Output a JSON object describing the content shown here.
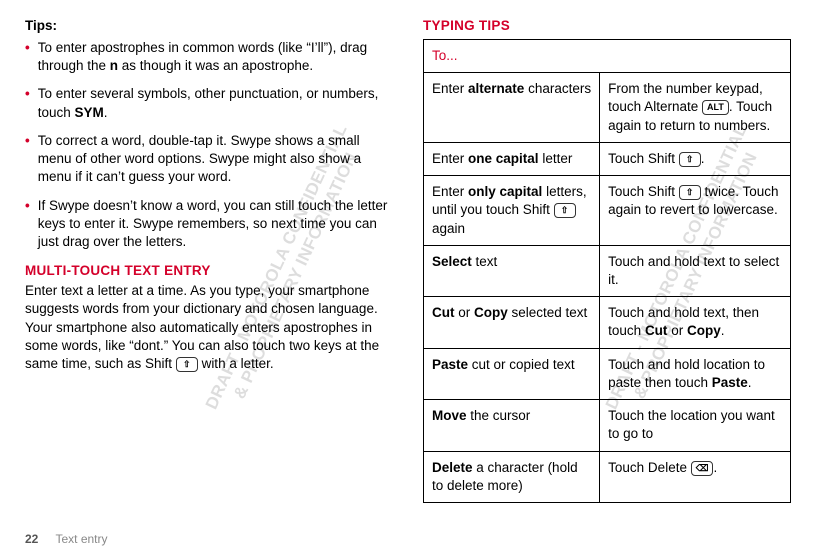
{
  "left": {
    "tipsLabel": "Tips:",
    "tips": [
      {
        "segments": [
          {
            "t": "To enter apostrophes in common words (like “I’ll”), drag through the "
          },
          {
            "t": "n",
            "b": true
          },
          {
            "t": " as though it was an apostrophe."
          }
        ]
      },
      {
        "segments": [
          {
            "t": "To enter several symbols, other punctuation, or numbers, touch "
          },
          {
            "t": "SYM",
            "b": true
          },
          {
            "t": "."
          }
        ]
      },
      {
        "segments": [
          {
            "t": "To correct a word, double-tap it. Swype shows a small menu of other word options. Swype might also show a menu if it can’t guess your word."
          }
        ]
      },
      {
        "segments": [
          {
            "t": "If Swype doesn’t know a word, you can still touch the letter keys to enter it. Swype remembers, so next time you can just drag over the letters."
          }
        ]
      }
    ],
    "mtHead": "Multi-touch text entry",
    "mtParaSegments": [
      {
        "t": "Enter text a letter at a time. As you type, your smartphone suggests words from your dictionary and chosen language. Your smartphone also automatically enters apostrophes in some words, like “dont.” You can also touch two keys at the same time, such as Shift "
      },
      {
        "key": "⇧"
      },
      {
        "t": " with a letter."
      }
    ]
  },
  "right": {
    "head": "Typing tips",
    "tableHeader": "To...",
    "rows": [
      {
        "left": [
          {
            "t": "Enter "
          },
          {
            "t": "alternate",
            "b": true
          },
          {
            "t": " characters"
          }
        ],
        "right": [
          {
            "t": "From the number keypad, touch Alternate "
          },
          {
            "key": "ALT"
          },
          {
            "t": ". Touch again to return to numbers."
          }
        ]
      },
      {
        "left": [
          {
            "t": "Enter "
          },
          {
            "t": "one capital",
            "b": true
          },
          {
            "t": " letter"
          }
        ],
        "right": [
          {
            "t": "Touch Shift "
          },
          {
            "key": "⇧"
          },
          {
            "t": "."
          }
        ]
      },
      {
        "left": [
          {
            "t": "Enter "
          },
          {
            "t": "only capital",
            "b": true
          },
          {
            "t": " letters, until you touch Shift "
          },
          {
            "key": "⇧"
          },
          {
            "t": " again"
          }
        ],
        "right": [
          {
            "t": "Touch Shift "
          },
          {
            "key": "⇧"
          },
          {
            "t": " twice. Touch again to revert to lowercase."
          }
        ]
      },
      {
        "left": [
          {
            "t": "Select",
            "b": true
          },
          {
            "t": " text"
          }
        ],
        "right": [
          {
            "t": "Touch and hold text to select it."
          }
        ]
      },
      {
        "left": [
          {
            "t": "Cut",
            "b": true
          },
          {
            "t": " or "
          },
          {
            "t": "Copy",
            "b": true
          },
          {
            "t": " selected text"
          }
        ],
        "right": [
          {
            "t": "Touch and hold text, then touch "
          },
          {
            "t": "Cut",
            "b": true
          },
          {
            "t": " or "
          },
          {
            "t": "Copy",
            "b": true
          },
          {
            "t": "."
          }
        ]
      },
      {
        "left": [
          {
            "t": "Paste",
            "b": true
          },
          {
            "t": " cut or copied text"
          }
        ],
        "right": [
          {
            "t": "Touch and hold location to paste then touch "
          },
          {
            "t": "Paste",
            "b": true
          },
          {
            "t": "."
          }
        ]
      },
      {
        "left": [
          {
            "t": "Move",
            "b": true
          },
          {
            "t": " the cursor"
          }
        ],
        "right": [
          {
            "t": "Touch the location you want to go to"
          }
        ]
      },
      {
        "left": [
          {
            "t": "Delete",
            "b": true
          },
          {
            "t": " a character (hold to delete more)"
          }
        ],
        "right": [
          {
            "t": "Touch Delete "
          },
          {
            "key": "⌫"
          },
          {
            "t": "."
          }
        ]
      }
    ]
  },
  "footer": {
    "page": "22",
    "section": "Text entry"
  },
  "watermark": "DRAFT - MOTOROLA CONFIDENTIAL\n& PROPRIETARY INFORMATION"
}
